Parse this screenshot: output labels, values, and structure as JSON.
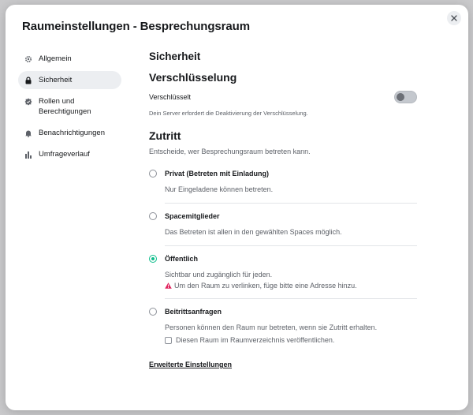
{
  "dialog": {
    "title": "Raumeinstellungen - Besprechungsraum",
    "close_icon": "close-icon"
  },
  "sidebar": {
    "items": [
      {
        "label": "Allgemein",
        "icon": "gear-icon",
        "active": false
      },
      {
        "label": "Sicherheit",
        "icon": "lock-icon",
        "active": true
      },
      {
        "label": "Rollen und\nBerechtigungen",
        "icon": "shield-check-icon",
        "active": false
      },
      {
        "label": "Benachrichtigungen",
        "icon": "bell-icon",
        "active": false
      },
      {
        "label": "Umfrageverlauf",
        "icon": "bar-chart-icon",
        "active": false
      }
    ]
  },
  "security": {
    "heading": "Sicherheit",
    "encryption": {
      "heading": "Verschlüsselung",
      "toggle_label": "Verschlüsselt",
      "toggle_on": false,
      "note": "Dein Server erfordert die Deaktivierung der Verschlüsselung."
    },
    "access": {
      "heading": "Zutritt",
      "description": "Entscheide, wer Besprechungsraum betreten kann.",
      "options": [
        {
          "label": "Privat (Betreten mit Einladung)",
          "description": "Nur Eingeladene können betreten.",
          "selected": false
        },
        {
          "label": "Spacemitglieder",
          "description": "Das Betreten ist allen in den gewählten Spaces möglich.",
          "selected": false
        },
        {
          "label": "Öffentlich",
          "description": "Sichtbar und zugänglich für jeden.",
          "warning": "Um den Raum zu verlinken, füge bitte eine Adresse hinzu.",
          "selected": true
        },
        {
          "label": "Beitrittsanfragen",
          "description": "Personen können den Raum nur betreten, wenn sie Zutritt erhalten.",
          "checkbox_label": "Diesen Raum im Raumverzeichnis veröffentlichen.",
          "selected": false
        }
      ]
    },
    "advanced_link": "Erweiterte Einstellungen"
  },
  "colors": {
    "accent": "#0dbd8b",
    "warning": "#e0245e"
  }
}
